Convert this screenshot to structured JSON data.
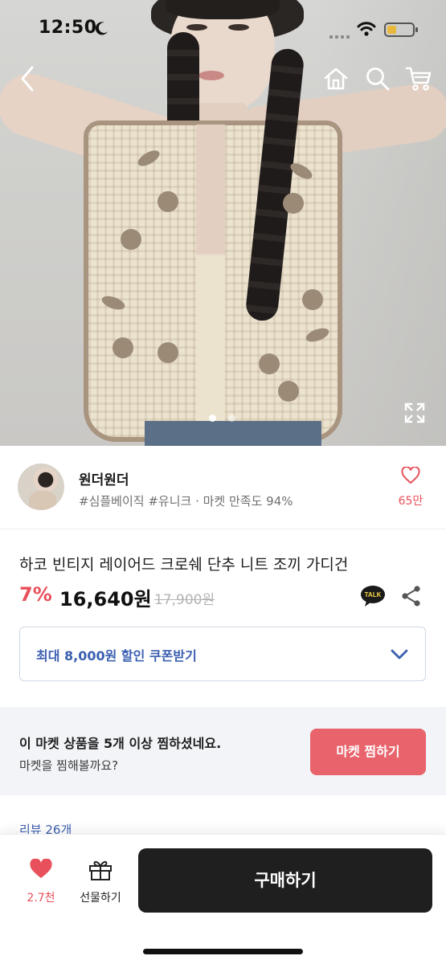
{
  "status_bar": {
    "time": "12:50",
    "icons": [
      "moon-icon",
      "signal-icon",
      "wifi-icon",
      "battery-icon"
    ],
    "battery_color": "#e8b83a"
  },
  "top_nav": {
    "icons": [
      "back-icon",
      "home-icon",
      "search-icon",
      "cart-icon"
    ]
  },
  "gallery": {
    "current_index": 1,
    "dot_count": 2,
    "icons": [
      "expand-icon"
    ]
  },
  "shop": {
    "name": "원더원더",
    "tags": "#심플베이직 #유니크 · 마켓 만족도 94%",
    "favorite_count": "65만",
    "icons": [
      "heart-outline-icon"
    ]
  },
  "product": {
    "title": "하코 빈티지 레이어드 크로쉐 단추 니트 조끼 가디건",
    "discount": "7%",
    "price": "16,640원",
    "original_price": "17,900원",
    "talk_badge": "TALK",
    "icons": [
      "kakaotalk-icon",
      "share-icon"
    ]
  },
  "coupon": {
    "label": "최대 8,000원 할인 쿠폰받기",
    "icons": [
      "chevron-down-icon"
    ]
  },
  "follow_prompt": {
    "line1": "이 마켓 상품을 5개 이상 찜하셨네요.",
    "line2": "마켓을 찜해볼까요?",
    "button": "마켓 찜하기"
  },
  "reviews": {
    "label": "리뷰 26개"
  },
  "bottom_bar": {
    "like_count": "2.7천",
    "gift_label": "선물하기",
    "buy_label": "구매하기",
    "icons": [
      "heart-filled-icon",
      "gift-icon"
    ]
  },
  "colors": {
    "accent_red": "#e8505b",
    "button_red": "#e8636b",
    "link_blue": "#3b5fb0",
    "buy_dark": "#1f1f1f",
    "prompt_bg": "#f2f4f7"
  }
}
